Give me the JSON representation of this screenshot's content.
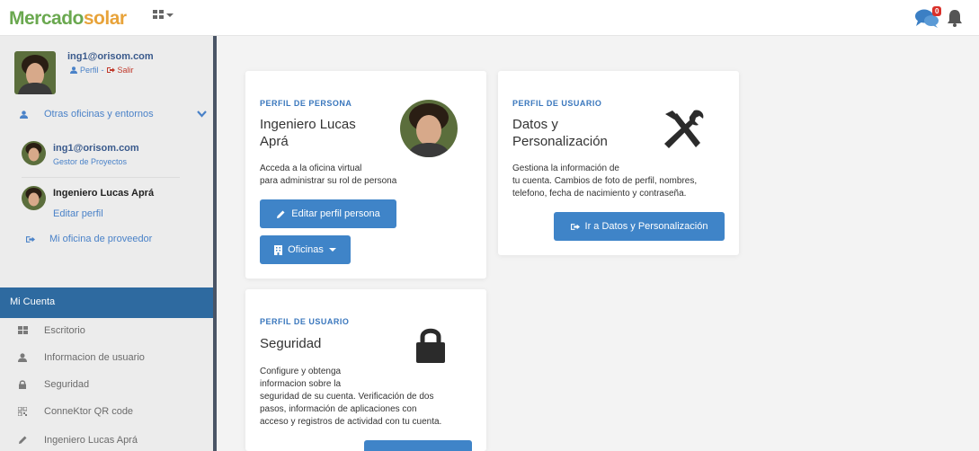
{
  "header": {
    "logo_part1": "Mercado",
    "logo_part2": "solar",
    "apps_icon": "grid-icon",
    "messages_count": "0",
    "messages_icon": "chat-icon",
    "notifications_icon": "bell-icon"
  },
  "sidebar": {
    "user_email": "ing1@orisom.com",
    "perfil_label": "Perfil",
    "separator": "-",
    "salir_label": "Salir",
    "otras_label": "Otras oficinas y entornos",
    "accounts": [
      {
        "name": "ing1@orisom.com",
        "role": "Gestor de Proyectos"
      },
      {
        "name": "Ingeniero Lucas Aprá"
      }
    ],
    "editar_perfil": "Editar perfil",
    "oficina_proveedor": "Mi oficina de proveedor",
    "section_title": "Mi Cuenta",
    "menu": [
      {
        "label": "Escritorio",
        "icon": "grid-icon"
      },
      {
        "label": "Informacion de usuario",
        "icon": "user-icon"
      },
      {
        "label": "Seguridad",
        "icon": "lock-icon"
      },
      {
        "label": "ConneKtor QR code",
        "icon": "qr-icon"
      },
      {
        "label": "Ingeniero Lucas Aprá",
        "icon": "pencil-icon"
      }
    ]
  },
  "cards": {
    "persona": {
      "kicker": "PERFIL DE PERSONA",
      "title_line1": "Ingeniero Lucas",
      "title_line2": "Aprá",
      "desc_line1": "Acceda a la oficina virtual",
      "desc_line2": "para administrar su rol de persona",
      "edit_button": "Editar perfil persona",
      "oficinas_button": "Oficinas"
    },
    "datos": {
      "kicker": "PERFIL DE USUARIO",
      "title_line1": "Datos y",
      "title_line2": "Personalización",
      "desc_line1": "Gestiona la información de",
      "desc_line2": "tu cuenta. Cambios de foto de perfil, nombres,",
      "desc_line3": "telefono, fecha de nacimiento y contraseña.",
      "button": "Ir a Datos y Personalización"
    },
    "seguridad": {
      "kicker": "PERFIL DE USUARIO",
      "title": "Seguridad",
      "desc_line1": "Configure y obtenga",
      "desc_line2": "informacion sobre la",
      "desc_line3": "seguridad de su cuenta. Verificación de dos",
      "desc_line4": "pasos, información de aplicaciones con",
      "desc_line5": "acceso y registros de actividad con tu cuenta."
    }
  },
  "colors": {
    "brand_green": "#6aa84f",
    "brand_orange": "#e8a33a",
    "primary_blue": "#3f84c8",
    "section_blue": "#2e6aa0"
  }
}
